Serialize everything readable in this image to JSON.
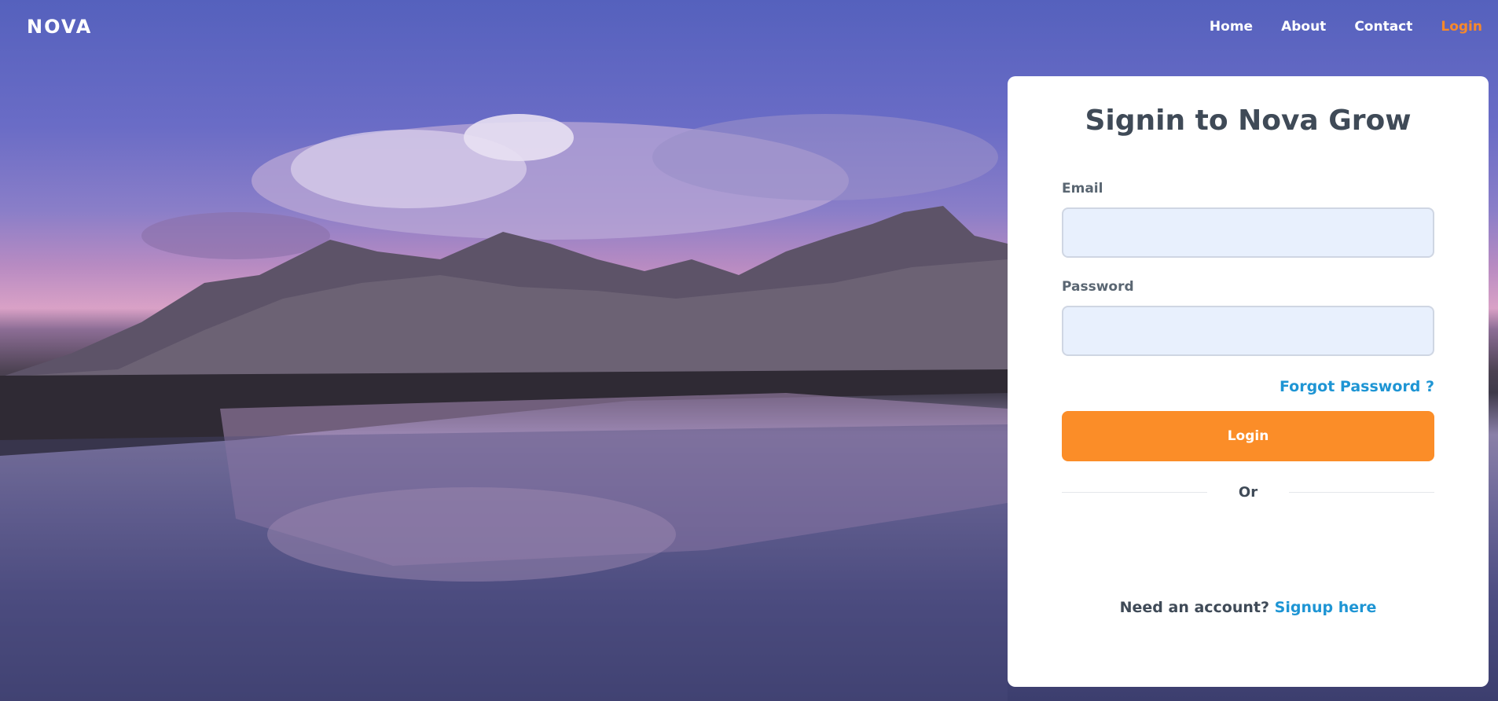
{
  "nav": {
    "brand": "NOVA",
    "links": [
      "Home",
      "About",
      "Contact",
      "Login"
    ],
    "active_link": "Login",
    "active_color": "#f7882a"
  },
  "card": {
    "title": "Signin to Nova Grow",
    "email_label": "Email",
    "email_value": "",
    "password_label": "Password",
    "password_value": "",
    "forgot_text": "Forgot Password ?",
    "login_button": "Login",
    "divider_text": "Or",
    "signup_prompt": "Need an account?",
    "signup_link": "Signup here"
  },
  "colors": {
    "accent_orange": "#fb8d28",
    "link_blue": "#1e95d4",
    "input_bg": "#e8f0fd",
    "title_text": "#3f4a57"
  }
}
